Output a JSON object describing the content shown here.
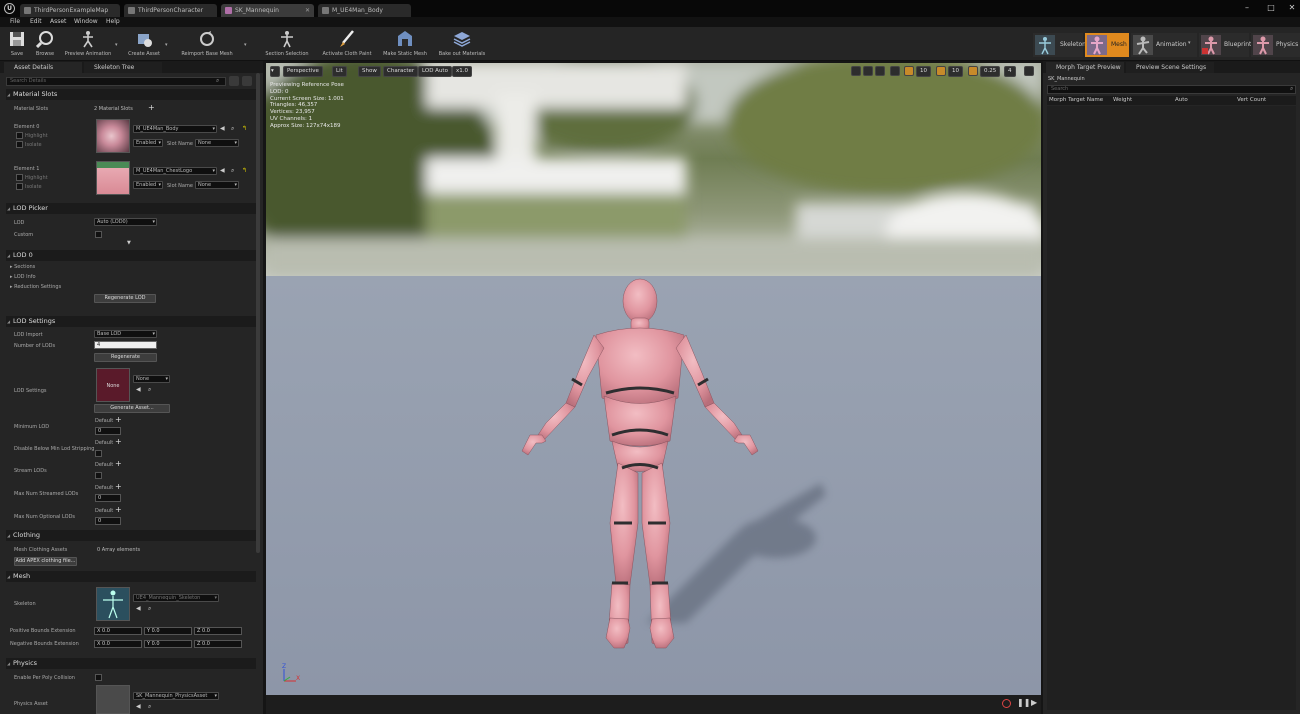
{
  "app": {
    "title_tabs": [
      {
        "label": "ThirdPersonExampleMap",
        "active": false
      },
      {
        "label": "ThirdPersonCharacter",
        "active": false
      },
      {
        "label": "SK_Mannequin",
        "active": true
      },
      {
        "label": "M_UE4Man_Body",
        "active": false
      }
    ],
    "window_controls": {
      "minimize": "–",
      "maximize": "□",
      "close": "✕"
    }
  },
  "menu": [
    "File",
    "Edit",
    "Asset",
    "Window",
    "Help"
  ],
  "toolbar": {
    "buttons": [
      {
        "label": "Save",
        "icon": "save-icon"
      },
      {
        "label": "Browse",
        "icon": "browse-icon"
      },
      {
        "label": "Preview Animation",
        "icon": "preview-animation-icon"
      },
      {
        "label": "Create Asset",
        "icon": "create-asset-icon"
      },
      {
        "label": "Reimport Base Mesh",
        "icon": "reimport-icon"
      },
      {
        "label": "Section Selection",
        "icon": "section-selection-icon"
      },
      {
        "label": "Activate Cloth Paint",
        "icon": "cloth-paint-icon"
      },
      {
        "label": "Make Static Mesh",
        "icon": "static-mesh-icon"
      },
      {
        "label": "Bake out Materials",
        "icon": "bake-materials-icon"
      }
    ],
    "modes": [
      {
        "label": "Skeleton",
        "active": false
      },
      {
        "label": "Mesh",
        "active": true
      },
      {
        "label": "Animation",
        "active": false
      },
      {
        "label": "Blueprint",
        "active": false
      },
      {
        "label": "Physics",
        "active": false
      }
    ]
  },
  "left_panel": {
    "tabs": [
      "Asset Details",
      "Skeleton Tree"
    ],
    "search_placeholder": "Search Details",
    "material_slots": {
      "header": "Material Slots",
      "label": "Material Slots",
      "count": "2 Material Slots",
      "elements": [
        {
          "label": "Element 0",
          "material": "M_UE4Man_Body",
          "highlight": "Highlight",
          "isolate": "Isolate",
          "enabled": "Enabled",
          "slot_name_label": "Slot Name",
          "slot_name": "None"
        },
        {
          "label": "Element 1",
          "material": "M_UE4Man_ChestLogo",
          "highlight": "Highlight",
          "isolate": "Isolate",
          "enabled": "Enabled",
          "slot_name_label": "Slot Name",
          "slot_name": "None"
        }
      ]
    },
    "lod_picker": {
      "header": "LOD Picker",
      "lod_label": "LOD",
      "lod_value": "Auto (LOD0)",
      "custom_label": "Custom"
    },
    "lod0": {
      "header": "LOD 0",
      "items": [
        "Sections",
        "LOD Info",
        "Reduction Settings"
      ],
      "regenerate_button": "Regenerate LOD"
    },
    "lod_settings": {
      "header": "LOD Settings",
      "lod_import_label": "LOD Import",
      "lod_import_value": "Base LOD",
      "num_lods_label": "Number of LODs",
      "num_lods_value": "4",
      "regenerate_button": "Regenerate",
      "lod_settings_label": "LOD Settings",
      "lod_settings_thumb": "None",
      "lod_settings_value": "None",
      "generate_asset_button": "Generate Asset...",
      "minimum_lod_label": "Minimum LOD",
      "default_label": "Default",
      "minimum_lod_value": "0",
      "disable_below_label": "Disable Below Min Lod Stripping",
      "stream_lods_label": "Stream LODs",
      "max_streamed_label": "Max Num Streamed LODs",
      "max_streamed_value": "0",
      "max_optional_label": "Max Num Optional LODs",
      "max_optional_value": "0"
    },
    "clothing": {
      "header": "Clothing",
      "mesh_assets_label": "Mesh Clothing Assets",
      "mesh_assets_value": "0 Array elements",
      "add_button": "Add APEX clothing file..."
    },
    "mesh": {
      "header": "Mesh",
      "skeleton_label": "Skeleton",
      "skeleton_value": "UE4_Mannequin_Skeleton",
      "positive_bounds_label": "Positive Bounds Extension",
      "negative_bounds_label": "Negative Bounds Extension",
      "bounds": [
        "X 0.0",
        "Y 0.0",
        "Z 0.0"
      ]
    },
    "physics": {
      "header": "Physics",
      "per_poly_label": "Enable Per Poly Collision",
      "physics_asset_label": "Physics Asset",
      "physics_asset_value": "SK_Mannequin_PhysicsAsset"
    }
  },
  "viewport": {
    "toolbar": {
      "perspective": "Perspective",
      "lit": "Lit",
      "show": "Show",
      "character": "Character",
      "lod": "LOD Auto",
      "speed": "x1.0",
      "grid_snap": "10",
      "rot_snap": "10",
      "scale_snap": "0.25",
      "camera_speed": "4"
    },
    "stats": [
      "Previewing Reference Pose",
      "LOD: 0",
      "Current Screen Size: 1.001",
      "Triangles: 46,357",
      "Vertices: 23,957",
      "UV Channels: 1",
      "Approx Size: 127x74x189"
    ],
    "axis": {
      "z": "Z",
      "x": "X"
    }
  },
  "right_panel": {
    "tabs": [
      "Morph Target Preview",
      "Preview Scene Settings"
    ],
    "asset": "SK_Mannequin",
    "search_placeholder": "Search",
    "columns": [
      "Morph Target Name",
      "Weight",
      "Auto",
      "Vert Count"
    ]
  }
}
